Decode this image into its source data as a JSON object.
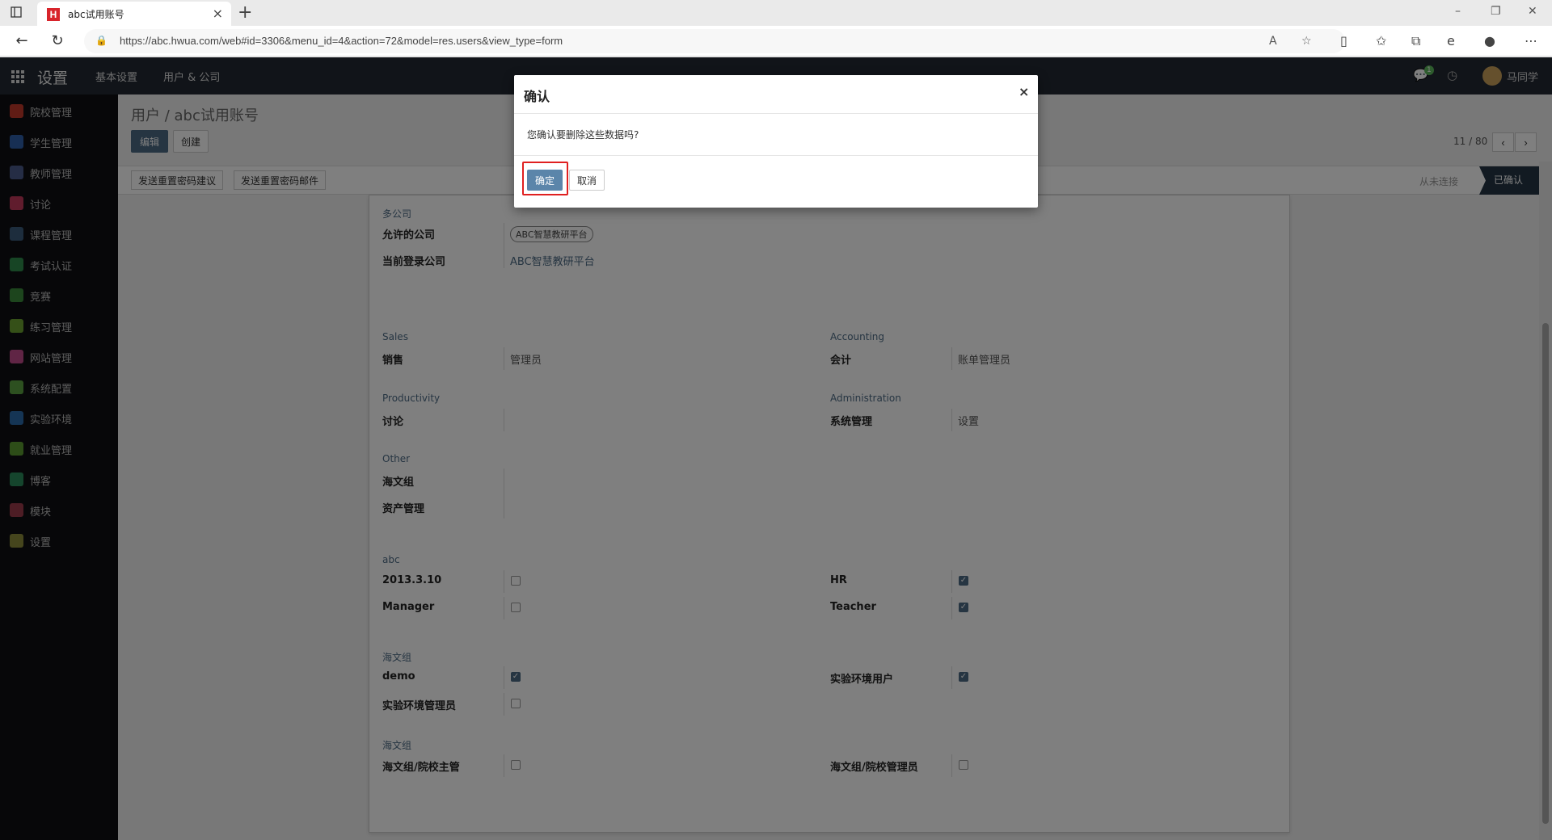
{
  "browser": {
    "tab_title": "abc试用账号",
    "favicon_letter": "H",
    "url": "https://abc.hwua.com/web#id=3306&menu_id=4&action=72&model=res.users&view_type=form"
  },
  "navbar": {
    "app_title": "设置",
    "menus": [
      "基本设置",
      "用户 & 公司"
    ],
    "chat_count": "1",
    "user_name": "马同学"
  },
  "sidebar": {
    "items": [
      {
        "label": "院校管理",
        "color": "#c0392b"
      },
      {
        "label": "学生管理",
        "color": "#2f5fa8"
      },
      {
        "label": "教师管理",
        "color": "#4a5a8a"
      },
      {
        "label": "讨论",
        "color": "#c0395b"
      },
      {
        "label": "课程管理",
        "color": "#3a5a7a"
      },
      {
        "label": "考试认证",
        "color": "#2e8a4a"
      },
      {
        "label": "竞赛",
        "color": "#3a8a3a"
      },
      {
        "label": "练习管理",
        "color": "#6aa030"
      },
      {
        "label": "网站管理",
        "color": "#c04a8a"
      },
      {
        "label": "系统配置",
        "color": "#5aa040"
      },
      {
        "label": "实验环境",
        "color": "#2a6aaa"
      },
      {
        "label": "就业管理",
        "color": "#5a9a30"
      },
      {
        "label": "博客",
        "color": "#2a8a5a"
      },
      {
        "label": "模块",
        "color": "#9a3a4a"
      },
      {
        "label": "设置",
        "color": "#8a8a3a"
      }
    ]
  },
  "main": {
    "breadcrumb": "用户 / abc试用账号",
    "edit_label": "编辑",
    "create_label": "创建",
    "pager": "11 / 80",
    "status_buttons": [
      "发送重置密码建议",
      "发送重置密码邮件"
    ],
    "stage_inactive": "从未连接",
    "stage_active": "已确认"
  },
  "form": {
    "multi_company": {
      "title": "多公司",
      "allowed_label": "允许的公司",
      "allowed_tag": "ABC智慧教研平台",
      "current_label": "当前登录公司",
      "current_value": "ABC智慧教研平台"
    },
    "sales": {
      "title": "Sales",
      "label": "销售",
      "value": "管理员"
    },
    "accounting": {
      "title": "Accounting",
      "label": "会计",
      "value": "账单管理员"
    },
    "productivity": {
      "title": "Productivity",
      "label": "讨论",
      "value": ""
    },
    "administration": {
      "title": "Administration",
      "label": "系统管理",
      "value": "设置"
    },
    "other": {
      "title": "Other",
      "labels": [
        "海文组",
        "资产管理"
      ]
    },
    "abc": {
      "title": "abc",
      "left": [
        {
          "label": "2013.3.10",
          "checked": false
        },
        {
          "label": "Manager",
          "checked": false
        }
      ],
      "right": [
        {
          "label": "HR",
          "checked": true
        },
        {
          "label": "Teacher",
          "checked": true
        }
      ]
    },
    "haiwen1": {
      "title": "海文组",
      "left": [
        {
          "label": "demo",
          "checked": true
        },
        {
          "label": "实验环境管理员",
          "checked": false
        }
      ],
      "right": [
        {
          "label": "实验环境用户",
          "checked": true
        }
      ]
    },
    "haiwen2": {
      "title": "海文组",
      "left": [
        {
          "label": "海文组/院校主管",
          "checked": false
        }
      ],
      "right": [
        {
          "label": "海文组/院校管理员",
          "checked": false
        }
      ]
    }
  },
  "modal": {
    "title": "确认",
    "message": "您确认要删除这些数据吗?",
    "ok_label": "确定",
    "cancel_label": "取消"
  }
}
